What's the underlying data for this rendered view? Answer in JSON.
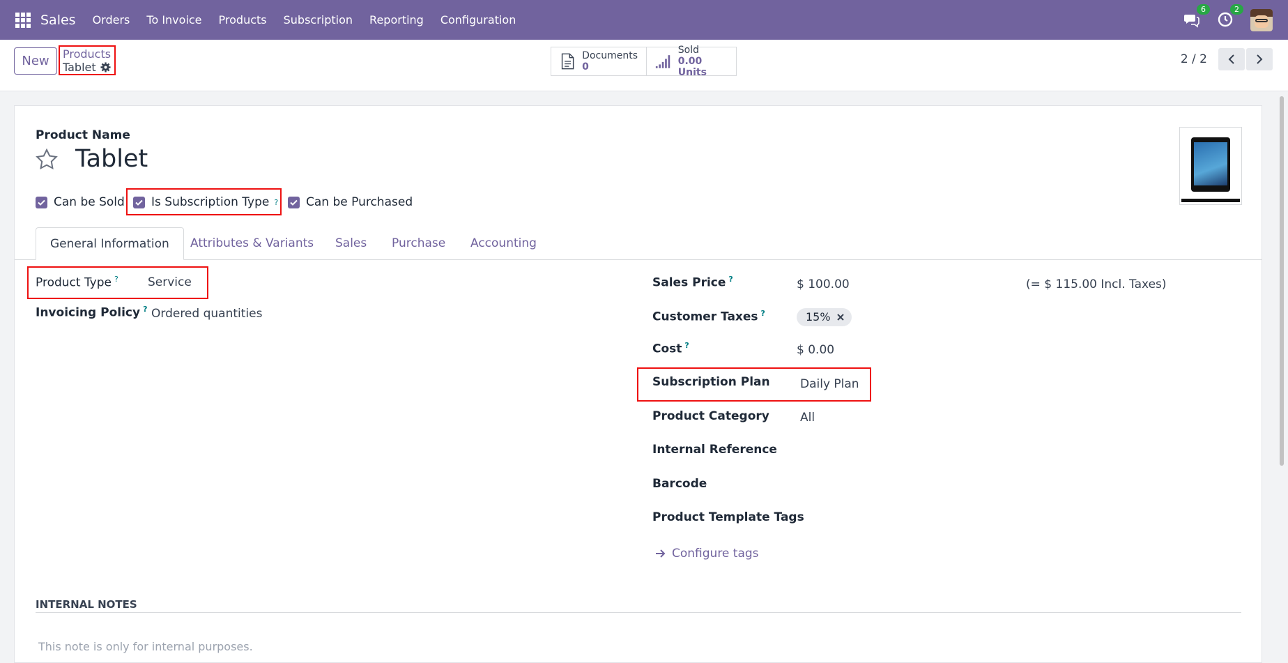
{
  "navbar": {
    "app_name": "Sales",
    "menu": [
      "Orders",
      "To Invoice",
      "Products",
      "Subscription",
      "Reporting",
      "Configuration"
    ],
    "messages_count": "6",
    "activities_count": "2"
  },
  "control": {
    "new_label": "New",
    "breadcrumb_parent": "Products",
    "breadcrumb_current": "Tablet",
    "smart_buttons": [
      {
        "label": "Documents",
        "value": "0",
        "icon": "document-icon"
      },
      {
        "label": "Sold",
        "value": "0.00 Units",
        "icon": "bar-chart-icon"
      }
    ],
    "pager": "2 / 2"
  },
  "form": {
    "product_name_label": "Product Name",
    "product_name": "Tablet",
    "checkboxes": [
      {
        "label": "Can be Sold",
        "checked": true
      },
      {
        "label": "Is Subscription Type",
        "checked": true
      },
      {
        "label": "Can be Purchased",
        "checked": true
      }
    ],
    "tabs": [
      "General Information",
      "Attributes & Variants",
      "Sales",
      "Purchase",
      "Accounting"
    ],
    "left_fields": [
      {
        "label": "Product Type",
        "value": "Service"
      },
      {
        "label": "Invoicing Policy",
        "value": "Ordered quantities"
      }
    ],
    "right_fields": {
      "sales_price_label": "Sales Price",
      "sales_price": "$ 100.00",
      "incl_taxes": "(= $ 115.00 Incl. Taxes)",
      "customer_taxes_label": "Customer Taxes",
      "customer_tax_tag": "15%",
      "cost_label": "Cost",
      "cost": "$ 0.00",
      "subscription_plan_label": "Subscription Plan",
      "subscription_plan": "Daily Plan",
      "product_category_label": "Product Category",
      "product_category": "All",
      "internal_reference_label": "Internal Reference",
      "barcode_label": "Barcode",
      "product_template_tags_label": "Product Template Tags",
      "configure_tags": "Configure tags"
    },
    "internal_notes_label": "INTERNAL NOTES",
    "internal_notes_placeholder": "This note is only for internal purposes.",
    "help_mark": "?"
  },
  "colors": {
    "brand": "#71639e",
    "highlight": "#e11111",
    "badge": "#28a745"
  }
}
